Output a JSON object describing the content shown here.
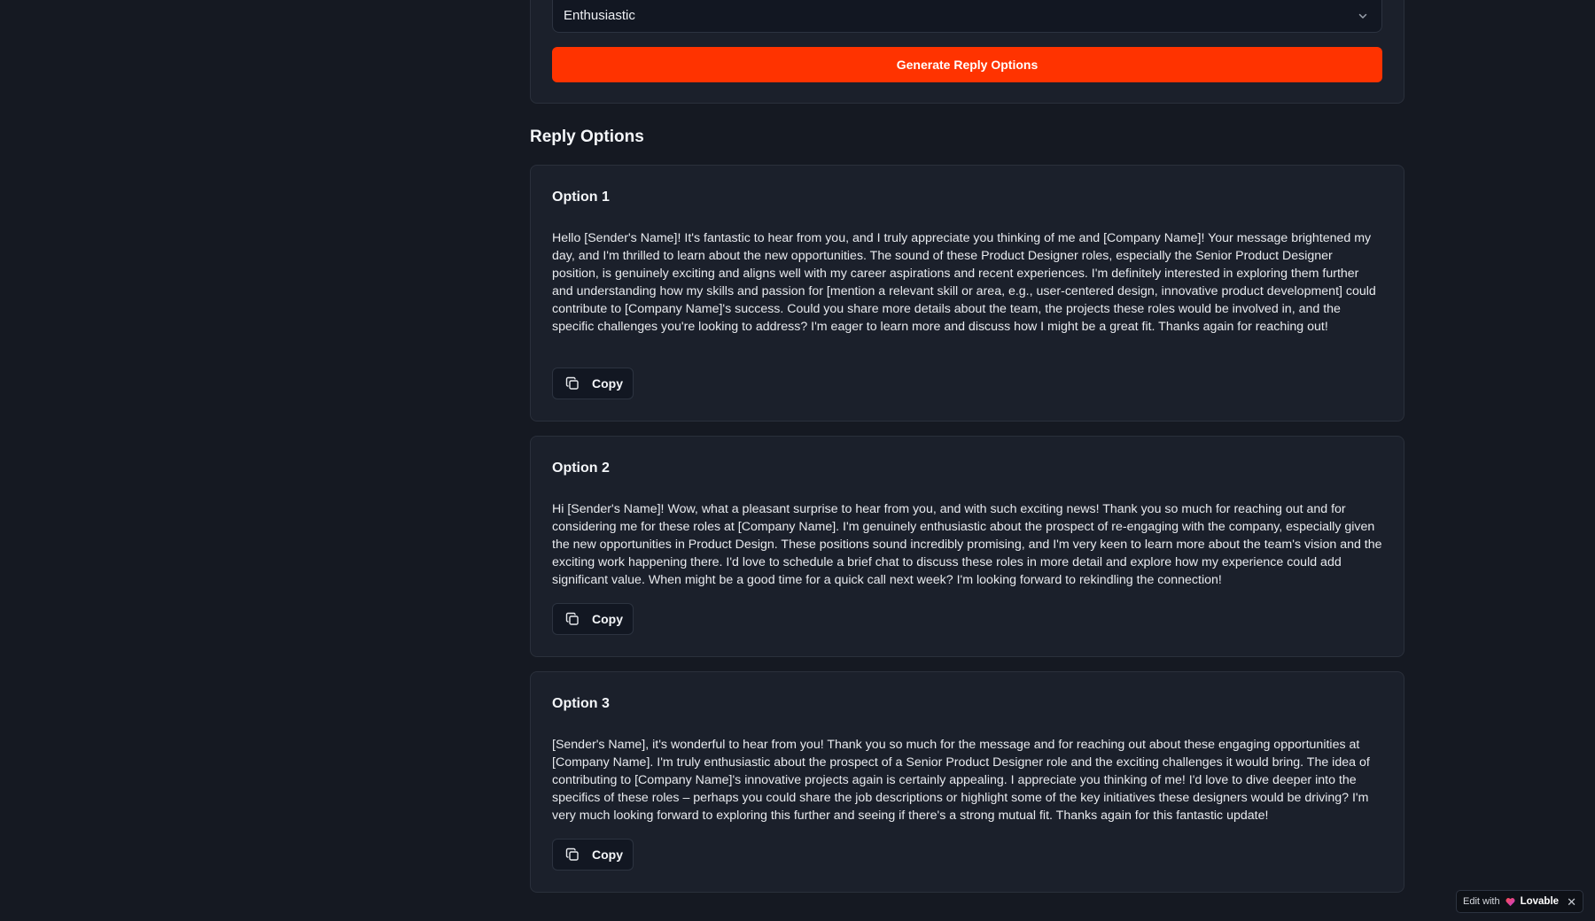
{
  "form": {
    "tone_select": {
      "value": "Enthusiastic",
      "icon": "chevron-down-icon"
    },
    "generate_button": "Generate Reply Options"
  },
  "reply_section": {
    "title": "Reply Options",
    "options": [
      {
        "title": "Option 1",
        "text": "Hello [Sender's Name]! It's fantastic to hear from you, and I truly appreciate you thinking of me and [Company Name]! Your message brightened my day, and I'm thrilled to learn about the new opportunities. The sound of these Product Designer roles, especially the Senior Product Designer position, is genuinely exciting and aligns well with my career aspirations and recent experiences. I'm definitely interested in exploring them further and understanding how my skills and passion for [mention a relevant skill or area, e.g., user-centered design, innovative product development] could contribute to [Company Name]'s success. Could you share more details about the team, the projects these roles would be involved in, and the specific challenges you're looking to address? I'm eager to learn more and discuss how I might be a great fit. Thanks again for reaching out!",
        "copy_label": "Copy"
      },
      {
        "title": "Option 2",
        "text": "Hi [Sender's Name]! Wow, what a pleasant surprise to hear from you, and with such exciting news! Thank you so much for reaching out and for considering me for these roles at [Company Name]. I'm genuinely enthusiastic about the prospect of re-engaging with the company, especially given the new opportunities in Product Design. These positions sound incredibly promising, and I'm very keen to learn more about the team's vision and the exciting work happening there. I'd love to schedule a brief chat to discuss these roles in more detail and explore how my experience could add significant value. When might be a good time for a quick call next week? I'm looking forward to rekindling the connection!",
        "copy_label": "Copy"
      },
      {
        "title": "Option 3",
        "text": "[Sender's Name], it's wonderful to hear from you! Thank you so much for the message and for reaching out about these engaging opportunities at [Company Name]. I'm truly enthusiastic about the prospect of a Senior Product Designer role and the exciting challenges it would bring. The idea of contributing to [Company Name]'s innovative projects again is certainly appealing. I appreciate you thinking of me! I'd love to dive deeper into the specifics of these roles – perhaps you could share the job descriptions or highlight some of the key initiatives these designers would be driving? I'm very much looking forward to exploring this further and seeing if there's a strong mutual fit. Thanks again for this fantastic update!",
        "copy_label": "Copy"
      }
    ]
  },
  "badge": {
    "prefix": "Edit with",
    "brand": "Lovable",
    "close": "✕"
  },
  "colors": {
    "background": "#151922",
    "card": "#1b202b",
    "accent": "#ff3300"
  }
}
